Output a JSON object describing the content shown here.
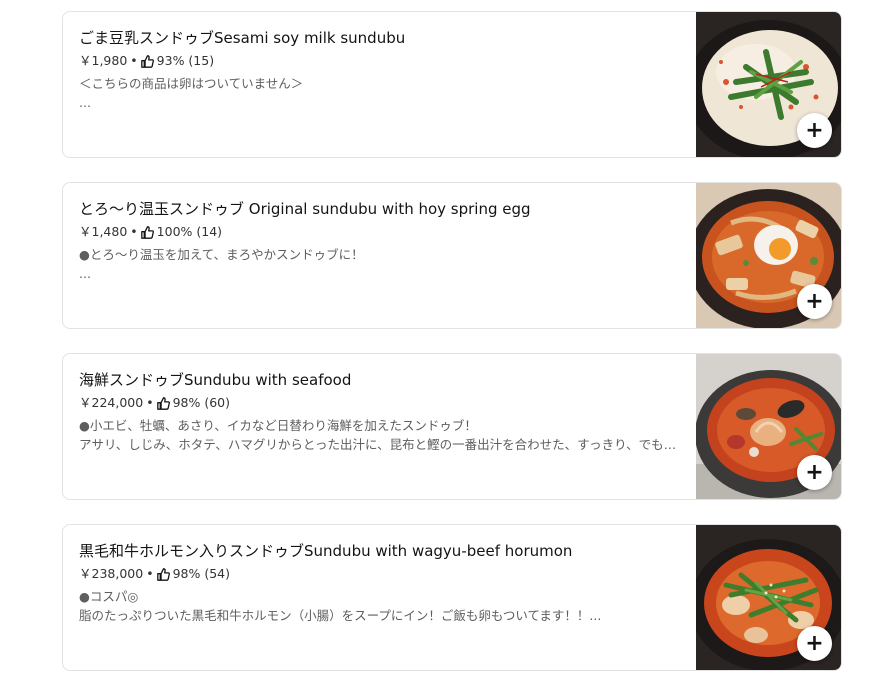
{
  "items": [
    {
      "title": "ごま豆乳スンドゥブSesami soy milk sundubu",
      "price": "￥1,980",
      "rating": "93% (15)",
      "desc1": "＜こちらの商品は卵はついていません＞",
      "desc2": "...",
      "image": "sesame-soy-milk-sundubu-photo"
    },
    {
      "title": "とろ〜り温玉スンドゥブ Original sundubu with hoy spring egg",
      "price": "￥1,480",
      "rating": "100% (14)",
      "desc1": "●とろ〜り温玉を加えて、まろやかスンドゥブに！",
      "desc2": "...",
      "image": "original-sundubu-egg-photo"
    },
    {
      "title": "海鮮スンドゥブSundubu with seafood",
      "price": "￥224,000",
      "rating": "98% (60)",
      "desc1": "●小エビ、牡蠣、あさり、イカなど日替わり海鮮を加えたスンドゥブ！",
      "desc2": "アサリ、しじみ、ホタテ、ハマグリからとった出汁に、昆布と鰹の一番出汁を合わせた、すっきり、でもコクのあるヤ...",
      "image": "seafood-sundubu-photo"
    },
    {
      "title": "黒毛和牛ホルモン入りスンドゥブSundubu with wagyu-beef horumon",
      "price": "￥238,000",
      "rating": "98% (54)",
      "desc1": "●コスパ◎",
      "desc2": "脂のたっぷりついた黒毛和牛ホルモン（小腸）をスープにイン！ご飯も卵もついてます！！...",
      "image": "wagyu-horumon-sundubu-photo"
    }
  ],
  "separator": "•",
  "add_label": "+",
  "thumb_icon": "thumbs-up-icon"
}
